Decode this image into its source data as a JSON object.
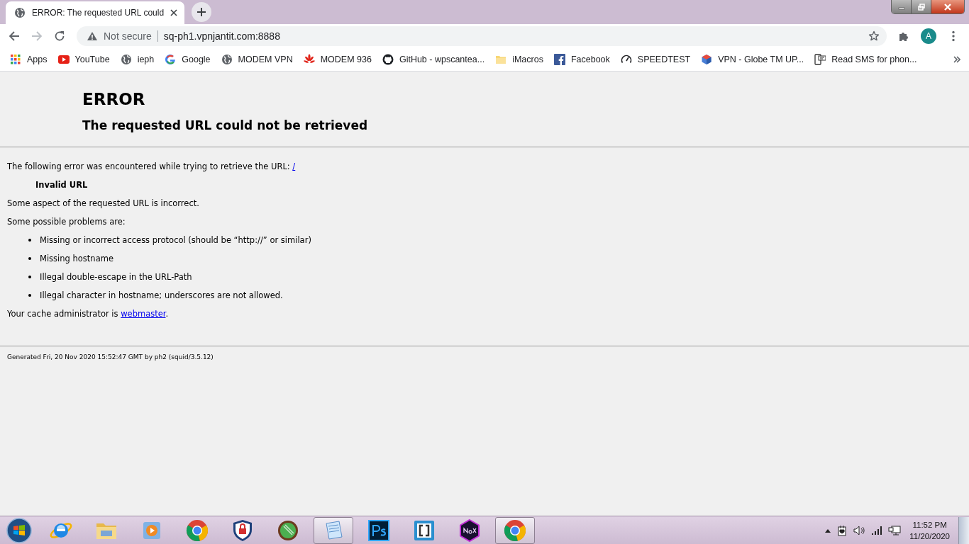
{
  "browser": {
    "tabs": [
      {
        "title": "ERROR: The requested URL could",
        "selected": true
      }
    ],
    "toolbar": {
      "back": {
        "disabled": false
      },
      "forward": {
        "disabled": true
      },
      "security_label": "Not secure",
      "url": "sq-ph1.vpnjantit.com:8888",
      "avatar": "A"
    },
    "bookmarks": [
      {
        "kind": "apps",
        "label": "Apps"
      },
      {
        "kind": "youtube",
        "label": "YouTube"
      },
      {
        "kind": "globe",
        "label": "ieph"
      },
      {
        "kind": "google",
        "label": "Google"
      },
      {
        "kind": "globe",
        "label": "MODEM VPN"
      },
      {
        "kind": "flower",
        "label": "MODEM 936"
      },
      {
        "kind": "github",
        "label": "GitHub - wpscantea..."
      },
      {
        "kind": "folder",
        "label": "iMacros"
      },
      {
        "kind": "facebook",
        "label": "Facebook"
      },
      {
        "kind": "gauge",
        "label": "SPEEDTEST"
      },
      {
        "kind": "cube",
        "label": "VPN - Globe TM UP..."
      },
      {
        "kind": "sms",
        "label": "Read SMS for phon..."
      }
    ]
  },
  "page": {
    "title": "ERROR",
    "subtitle": "The requested URL could not be retrieved",
    "intro": {
      "text": "The following error was encountered while trying to retrieve the URL: ",
      "link": "/"
    },
    "error_name": "Invalid URL",
    "description": "Some aspect of the requested URL is incorrect.",
    "problems_heading": "Some possible problems are:",
    "problems": [
      "Missing or incorrect access protocol (should be “http://” or similar)",
      "Missing hostname",
      "Illegal double-escape in the URL-Path",
      "Illegal character in hostname; underscores are not allowed."
    ],
    "admin": {
      "text": "Your cache administrator is ",
      "link": "webmaster",
      "after": "."
    },
    "footer": "Generated Fri, 20 Nov 2020 15:52:47 GMT by ph2 (squid/3.5.12)"
  },
  "taskbar": {
    "apps": [
      {
        "kind": "ie",
        "selected": false
      },
      {
        "kind": "folder",
        "selected": false
      },
      {
        "kind": "media",
        "selected": false
      },
      {
        "kind": "chrome",
        "selected": false
      },
      {
        "kind": "shield",
        "selected": false
      },
      {
        "kind": "green",
        "selected": false
      },
      {
        "kind": "notepad",
        "selected": true
      },
      {
        "kind": "ps",
        "selected": false
      },
      {
        "kind": "brackets",
        "selected": false
      },
      {
        "kind": "nox",
        "selected": false
      },
      {
        "kind": "chrome",
        "selected": true
      }
    ],
    "clock": {
      "time": "11:52 PM",
      "date": "11/20/2020"
    }
  }
}
